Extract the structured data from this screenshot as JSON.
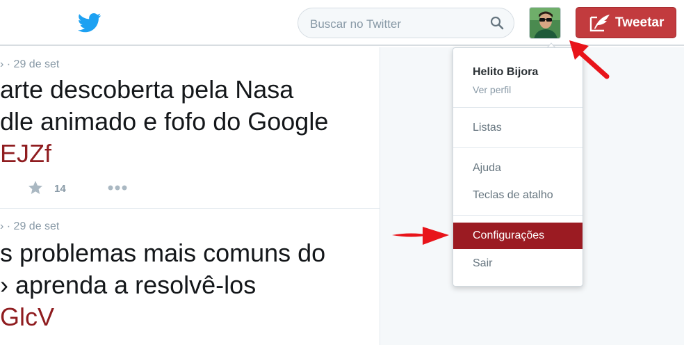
{
  "header": {
    "search_placeholder": "Buscar no Twitter",
    "tweet_button_label": "Tweetar"
  },
  "tweets": [
    {
      "meta": "› · 29 de set",
      "lines": [
        "arte descoberta pela Nasa",
        "dle animado e fofo do Google"
      ],
      "link": "EJZf",
      "favorites": "14"
    },
    {
      "meta": "› · 29 de set",
      "lines": [
        "s problemas mais comuns do",
        "› aprenda a resolvê-los"
      ],
      "link": "GlcV"
    }
  ],
  "menu": {
    "user_name": "Helito Bijora",
    "view_profile": "Ver perfil",
    "items": [
      {
        "label": "Listas"
      },
      {
        "label": "Ajuda"
      },
      {
        "label": "Teclas de atalho"
      },
      {
        "label": "Configurações",
        "active": true
      },
      {
        "label": "Sair"
      }
    ]
  },
  "colors": {
    "brand_blue": "#1da1f2",
    "tweet_button": "#c23b3e",
    "active_item": "#9b1b22",
    "link": "#8f1c1f",
    "annotation_arrow": "#e8141a"
  }
}
